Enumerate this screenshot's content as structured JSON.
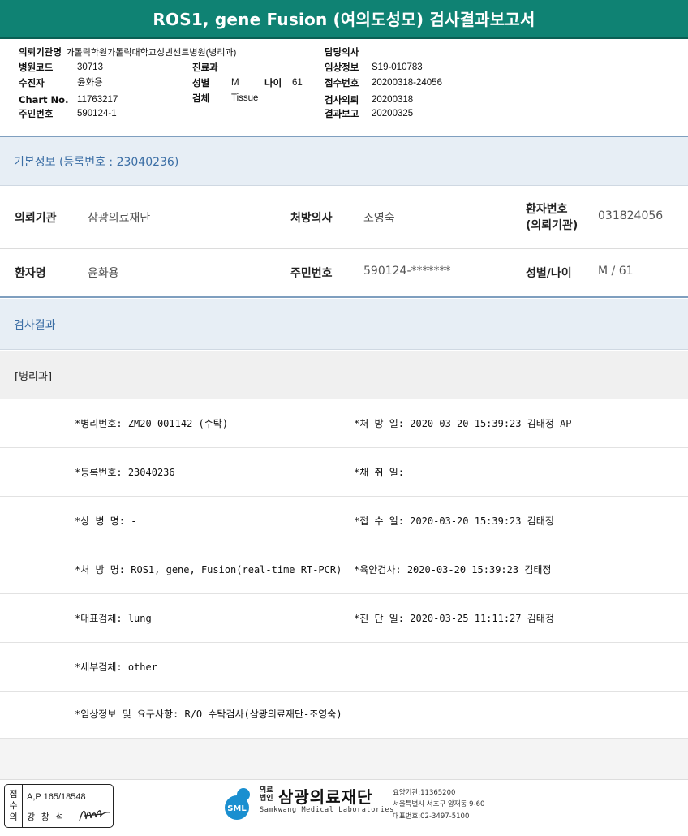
{
  "report": {
    "title": "ROS1, gene Fusion (여의도성모) 검사결과보고서"
  },
  "header": {
    "req_org_label": "의뢰기관명",
    "req_org_value": "가톨릭학원가톨릭대학교성빈센트병원(병리과)",
    "hosp_code_label": "병원코드",
    "hosp_code_value": "30713",
    "patient_label": "수진자",
    "patient_value": "윤화용",
    "chart_label": "Chart No.",
    "chart_value": "11763217",
    "rrn_label": "주민번호",
    "rrn_value": "590124-1",
    "dept_label": "진료과",
    "dept_value": "",
    "sex_label": "성별",
    "sex_value": "M",
    "age_label": "나이",
    "age_value": "61",
    "specimen_label": "검체",
    "specimen_value": "Tissue",
    "doctor_label": "담당의사",
    "doctor_value": "",
    "clinical_label": "임상정보",
    "clinical_value": "S19-010783",
    "receipt_label": "접수번호",
    "receipt_value": "20200318-24056",
    "test_req_label": "검사의뢰",
    "test_req_value": "20200318",
    "result_rep_label": "결과보고",
    "result_rep_value": "20200325"
  },
  "basic_info": {
    "title": "기본정보 (등록번호 : 23040236)",
    "org_label": "의뢰기관",
    "org_value": "삼광의료재단",
    "prescriber_label": "처방의사",
    "prescriber_value": "조영숙",
    "patno_label_1": "환자번호",
    "patno_label_2": "(의뢰기관)",
    "patno_value": "031824056",
    "name_label": "환자명",
    "name_value": "윤화용",
    "rrn_label": "주민번호",
    "rrn_value": "590124-*******",
    "sexage_label": "성별/나이",
    "sexage_value": "M / 61"
  },
  "results": {
    "title": "검사결과",
    "department": "[병리과]",
    "rows": [
      {
        "left": "*병리번호: ZM20-001142 (수탁)",
        "right": "*처 방 일: 2020-03-20 15:39:23  김태정 AP"
      },
      {
        "left": "*등록번호: 23040236",
        "right": "*채 취 일:"
      },
      {
        "left": "*상 병 명: -",
        "right": "*접 수 일: 2020-03-20 15:39:23  김태정"
      },
      {
        "left": "*처 방 명: ROS1, gene, Fusion(real-time RT-PCR)",
        "right": "*육안검사: 2020-03-20 15:39:23  김태정"
      },
      {
        "left": "*대표검체: lung",
        "right": "*진 단 일: 2020-03-25 11:11:27  김태정"
      },
      {
        "left": "*세부검체: other",
        "right": ""
      },
      {
        "left": "*임상정보 및 요구사항: R/O 수탁검사(삼광의료재단-조영숙)",
        "right": ""
      }
    ]
  },
  "footer": {
    "receipt_side": "접수의",
    "receipt_line1": "A,P 165/18548",
    "receipt_line2": "강 창 석",
    "logo_sub": "의료\n법인",
    "logo_name": "삼광의료재단",
    "logo_en": "Samkwang Medical Laboratories",
    "logo_mark_text": "SML",
    "contact_1": "요양기관:11365200",
    "contact_2": "서울특별시 서초구 양재동 9-60",
    "contact_3": "대표번호:02-3497-5100"
  },
  "colors": {
    "title_bar": "#0f8273",
    "section_text": "#3b6ea5",
    "section_bg": "#e7eef5",
    "logo_blue": "#1a8fd0"
  }
}
